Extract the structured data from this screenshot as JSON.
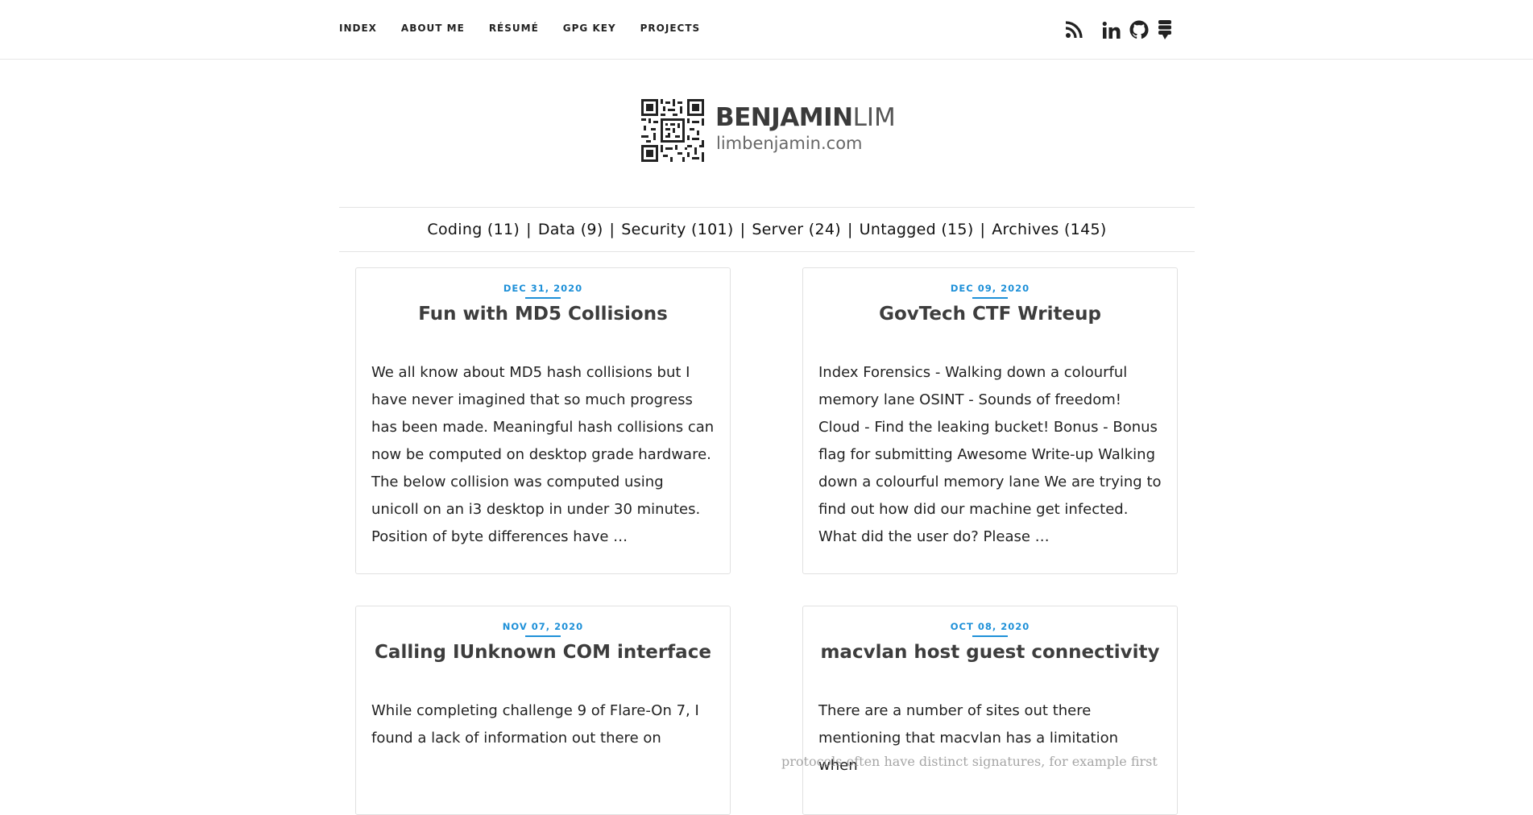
{
  "nav": {
    "items": [
      {
        "label": "INDEX"
      },
      {
        "label": "ABOUT ME"
      },
      {
        "label": "RÉSUMÉ"
      },
      {
        "label": "GPG KEY"
      },
      {
        "label": "PROJECTS"
      }
    ],
    "social_icons": [
      "rss-icon",
      "linkedin-icon",
      "github-icon",
      "stack-icon"
    ]
  },
  "brand": {
    "name_bold": "BENJAMIN",
    "name_light": "LIM",
    "domain": "limbenjamin.com",
    "logo_icon": "qr-code-icon"
  },
  "categories": [
    {
      "label": "Coding (11)"
    },
    {
      "label": "Data (9)"
    },
    {
      "label": "Security (101)"
    },
    {
      "label": "Server (24)"
    },
    {
      "label": "Untagged (15)"
    },
    {
      "label": "Archives (145)"
    }
  ],
  "separator": "|",
  "posts": [
    {
      "date": "DEC 31, 2020",
      "title": "Fun with MD5 Collisions",
      "excerpt": "We all know about MD5 hash collisions but I have never imagined that so much progress has been made. Meaningful hash collisions can now be computed on desktop grade hardware. The below collision was computed using unicoll on an i3 desktop in under 30 minutes. Position of byte differences have …"
    },
    {
      "date": "DEC 09, 2020",
      "title": "GovTech CTF Writeup",
      "excerpt": "Index Forensics - Walking down a colourful memory lane OSINT - Sounds of freedom! Cloud - Find the leaking bucket! Bonus - Bonus flag for submitting Awesome Write-up Walking down a colourful memory lane We are trying to find out how did our machine get infected. What did the user do? Please …"
    },
    {
      "date": "NOV 07, 2020",
      "title": "Calling IUnknown COM interface",
      "excerpt": "While completing challenge 9 of Flare-On 7, I found a lack of information out there on"
    },
    {
      "date": "OCT 08, 2020",
      "title": "macvlan host guest connectivity",
      "excerpt": "There are a number of sites out there mentioning that macvlan has a limitation when"
    }
  ],
  "overlay_text": "protocols often have distinct signatures, for example first",
  "colors": {
    "accent": "#1e90d8",
    "text": "#333333",
    "border": "#e1e1e1"
  }
}
